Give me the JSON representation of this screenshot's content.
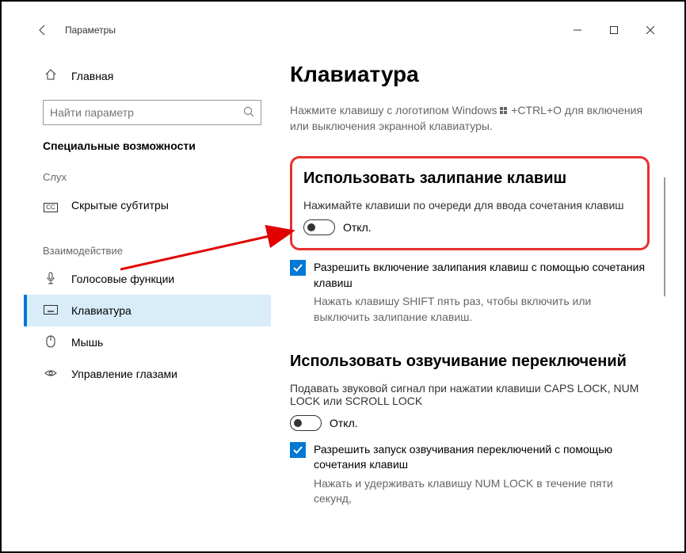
{
  "titlebar": {
    "title": "Параметры"
  },
  "sidebar": {
    "home": "Главная",
    "search_placeholder": "Найти параметр",
    "category": "Специальные возможности",
    "group_hearing": "Слух",
    "item_cc": "Скрытые субтитры",
    "group_interaction": "Взаимодействие",
    "item_speech": "Голосовые функции",
    "item_keyboard": "Клавиатура",
    "item_mouse": "Мышь",
    "item_eye": "Управление глазами"
  },
  "main": {
    "page_title": "Клавиатура",
    "osk_hint_before": "Нажмите клавишу с логотипом Windows",
    "osk_hint_after": "+CTRL+O для включения или выключения экранной клавиатуры.",
    "sticky": {
      "title": "Использовать залипание клавиш",
      "subtitle": "Нажимайте клавиши по очереди для ввода сочетания клавиш",
      "toggle_state": "Откл.",
      "check_label": "Разрешить включение залипания клавиш с помощью сочетания клавиш",
      "check_hint": "Нажать клавишу SHIFT пять раз, чтобы включить или выключить залипание клавиш."
    },
    "toggle_keys": {
      "title": "Использовать озвучивание переключений",
      "subtitle": "Подавать звуковой сигнал при нажатии клавиши CAPS LOCK, NUM LOCK или SCROLL LOCK",
      "toggle_state": "Откл.",
      "check_label": "Разрешить запуск озвучивания переключений с помощью сочетания клавиш",
      "check_hint": "Нажать и удерживать клавишу NUM LOCK в течение пяти секунд,"
    }
  }
}
